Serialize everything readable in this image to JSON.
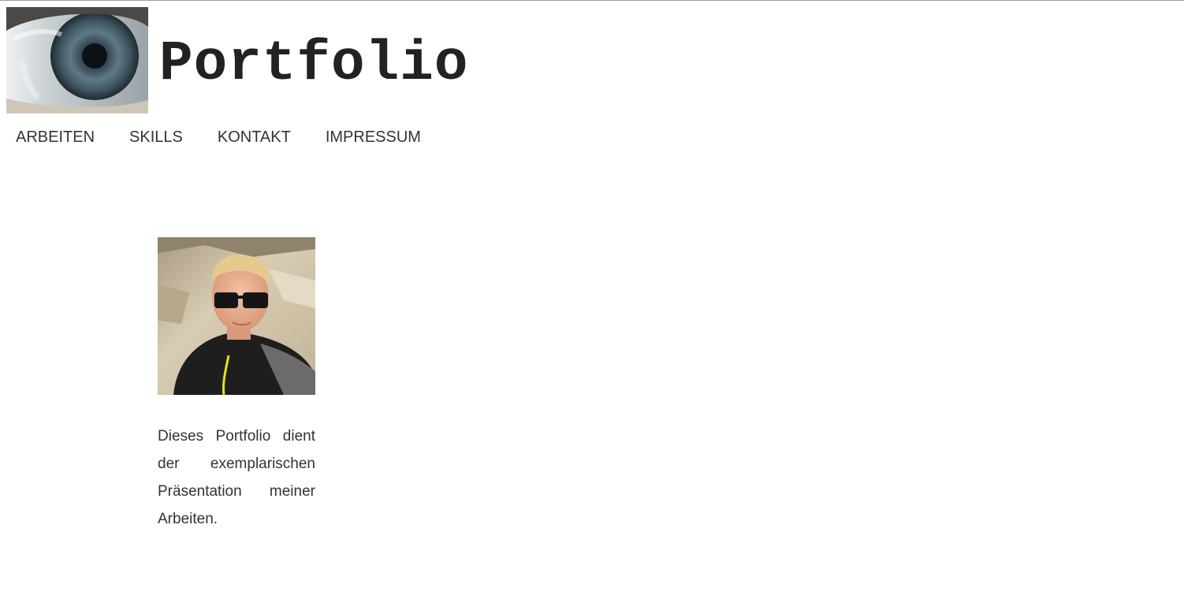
{
  "header": {
    "title": "Portfolio",
    "logo_icon": "eye-photo-icon"
  },
  "nav": {
    "items": [
      {
        "label": "ARBEITEN"
      },
      {
        "label": "SKILLS"
      },
      {
        "label": "KONTAKT"
      },
      {
        "label": "IMPRESSUM"
      }
    ]
  },
  "profile": {
    "portrait_icon": "portrait-photo-icon",
    "intro_text": "Dieses Portfolio dient der exemplarischen Präsentation meiner Arbeiten."
  },
  "colors": {
    "text": "#333333",
    "title": "#222222",
    "rule": "#9e9e9e",
    "background": "#ffffff"
  }
}
